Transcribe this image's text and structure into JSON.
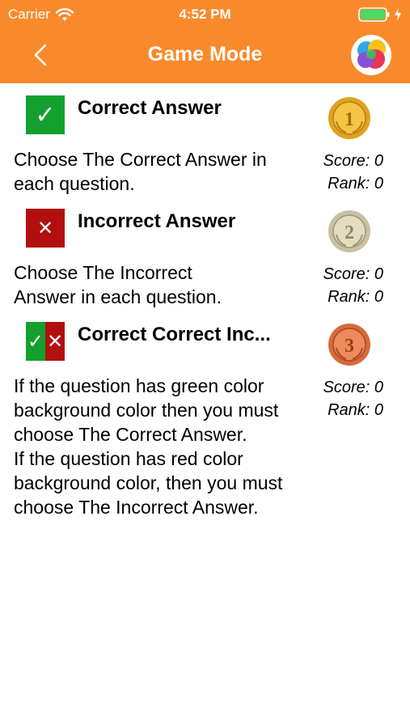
{
  "status_bar": {
    "carrier": "Carrier",
    "time": "4:52 PM"
  },
  "nav": {
    "title": "Game Mode",
    "back_icon": "chevron-left-icon",
    "right_icon": "game-center-icon"
  },
  "colors": {
    "header": "#F98A2B",
    "green": "#14A02E",
    "red": "#B30F10",
    "gold": "#E0A21F",
    "silver": "#C9C1A0",
    "bronze": "#D66A3A"
  },
  "modes": [
    {
      "title": "Correct Answer",
      "badge": "✓",
      "description": "Choose The Correct Answer in each question.",
      "medal_number": "1",
      "score": "Score: 0",
      "rank": "Rank: 0"
    },
    {
      "title": "Incorrect Answer",
      "badge": "✕",
      "description": "Choose The Incorrect Answer in each question.",
      "medal_number": "2",
      "score": "Score: 0",
      "rank": "Rank: 0"
    },
    {
      "title": "Correct Correct Inc...",
      "badge_left": "✓",
      "badge_right": "✕",
      "description_line1": "If the question has green color background color then you must choose The Correct Answer.",
      "description_line2": "If the question has red color background color, then you must choose The Incorrect Answer.",
      "medal_number": "3",
      "score": "Score: 0",
      "rank": "Rank: 0"
    }
  ]
}
